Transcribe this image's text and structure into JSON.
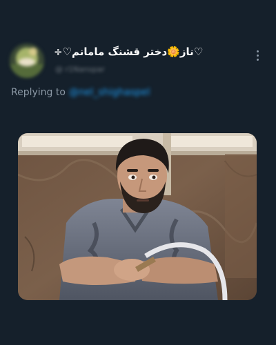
{
  "tweet": {
    "author": {
      "display_name": "÷♡ناز🌼دختر قشنگ مامانم♡",
      "handle": "@ r1Nanspar",
      "avatar_icon": "avatar-icon"
    },
    "more_icon": "more-vertical-icon",
    "replying": {
      "label": "Replying to",
      "handle": "@nel_shighaspel"
    },
    "media": {
      "type": "photo",
      "description": "meme photo of a bearded man staring, holding a hookah hose"
    }
  },
  "colors": {
    "background": "#15202b",
    "text_primary": "#ffffff",
    "text_secondary": "#8b98a5",
    "link": "#1d9bf0"
  }
}
